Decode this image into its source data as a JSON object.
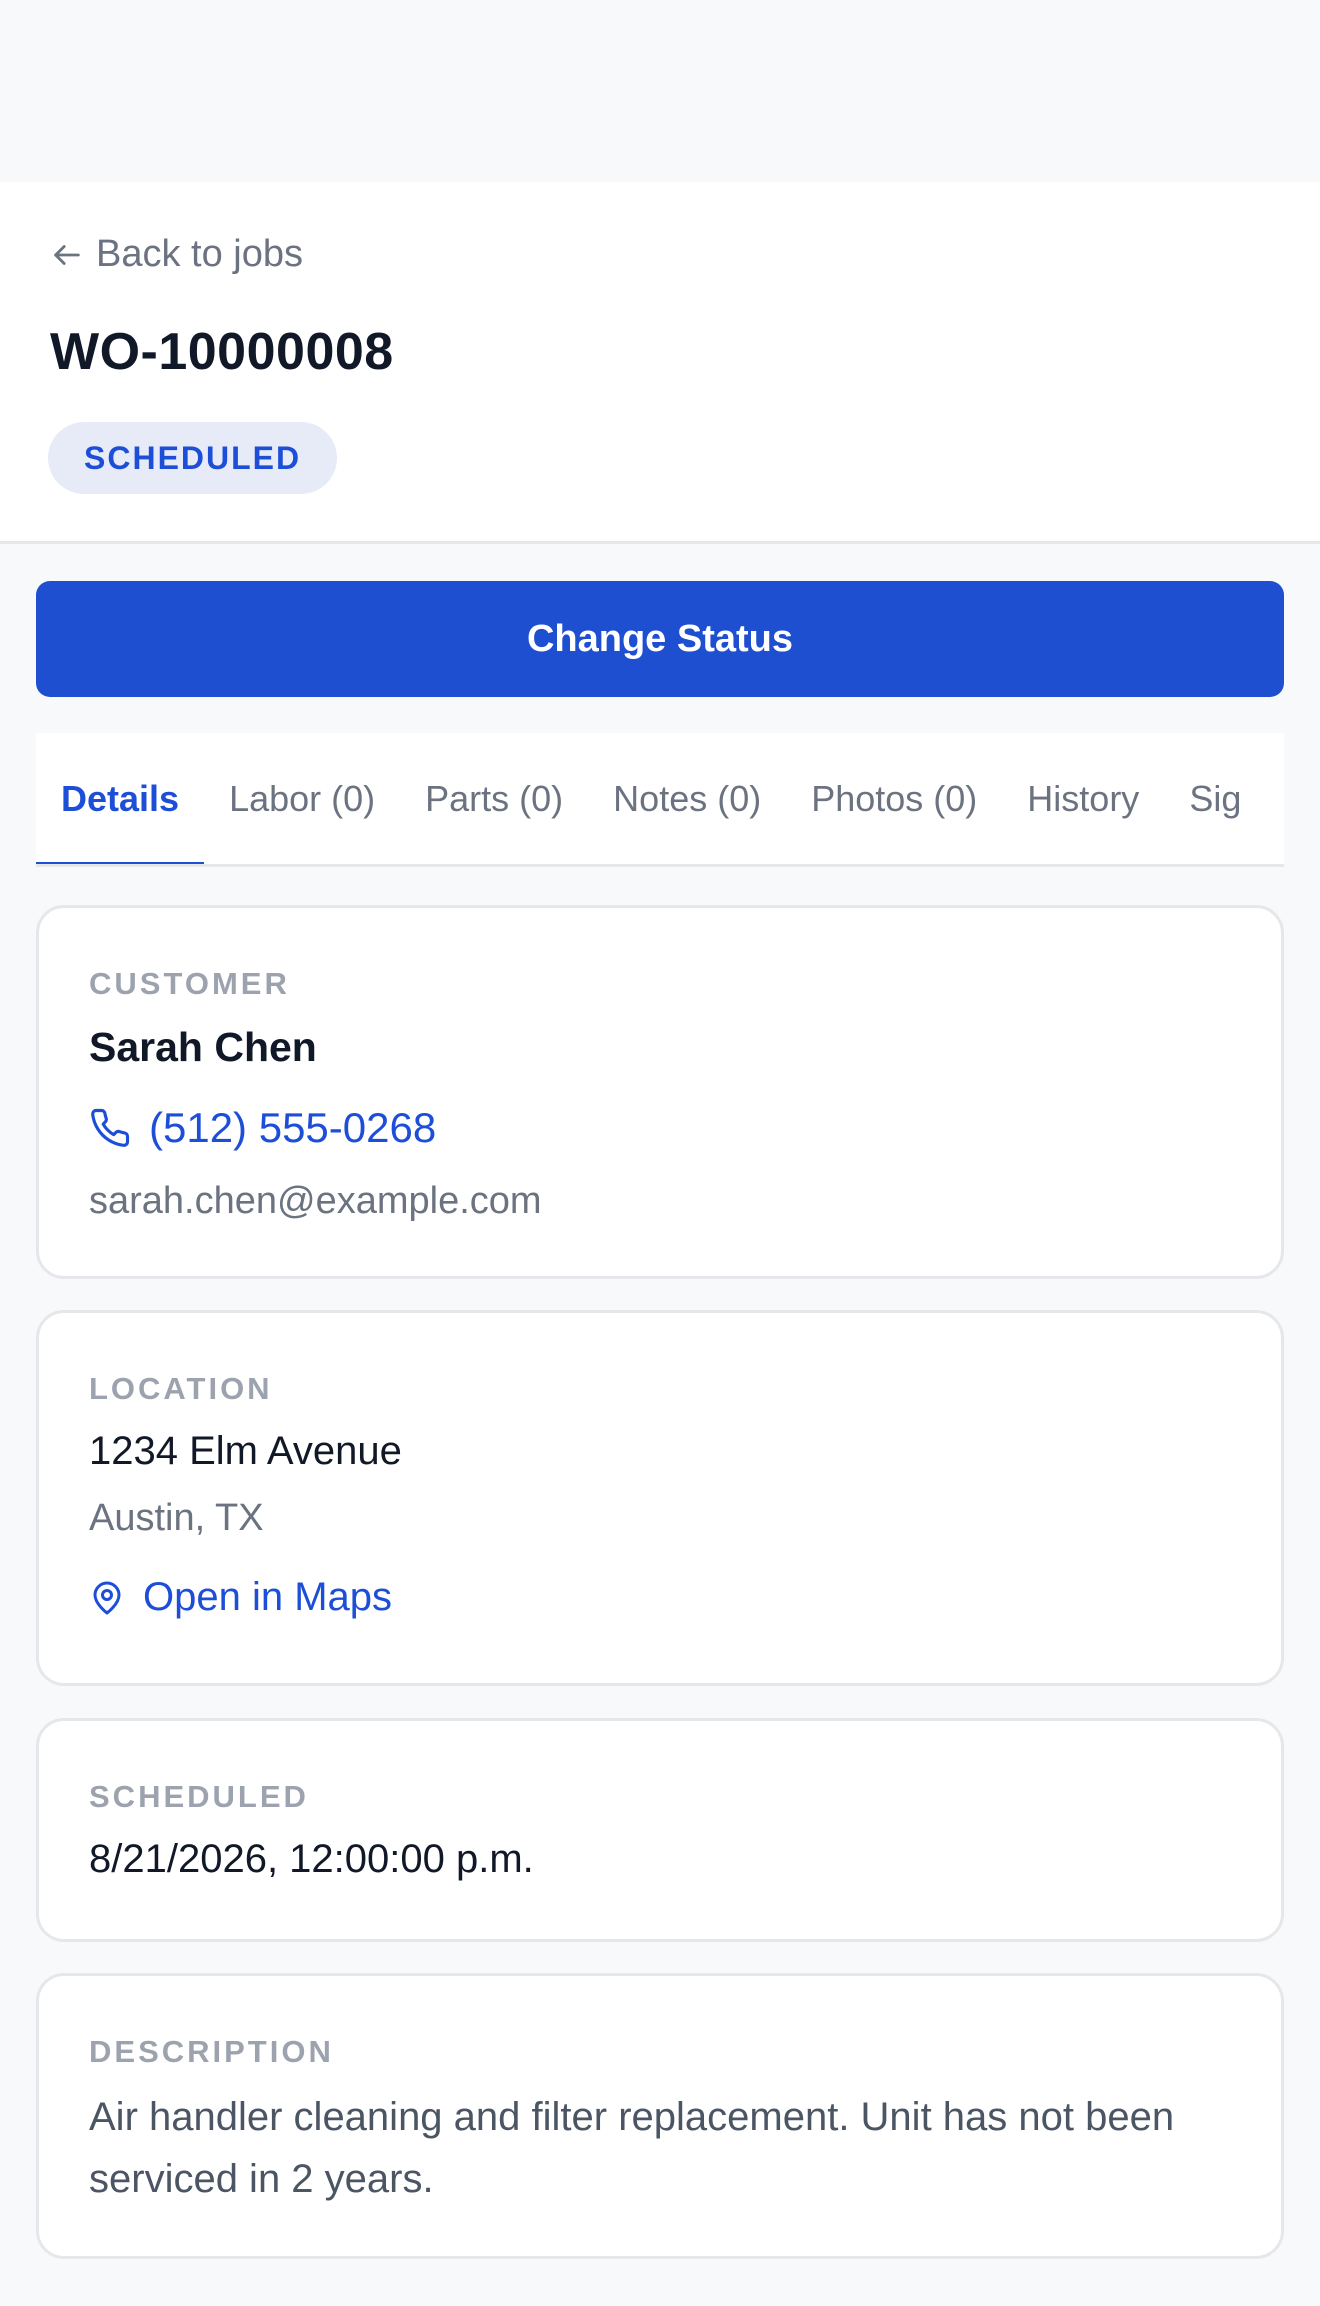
{
  "header": {
    "back_label": "Back to jobs",
    "job_number": "WO-10000008",
    "status": "SCHEDULED"
  },
  "actions": {
    "change_status_label": "Change Status"
  },
  "tabs": [
    {
      "label": "Details",
      "active": true
    },
    {
      "label": "Labor (0)",
      "active": false
    },
    {
      "label": "Parts (0)",
      "active": false
    },
    {
      "label": "Notes (0)",
      "active": false
    },
    {
      "label": "Photos (0)",
      "active": false
    },
    {
      "label": "History",
      "active": false
    },
    {
      "label": "Sig",
      "active": false
    }
  ],
  "customer": {
    "label": "CUSTOMER",
    "name": "Sarah Chen",
    "phone": "(512) 555-0268",
    "email": "sarah.chen@example.com"
  },
  "location": {
    "label": "LOCATION",
    "street": "1234 Elm Avenue",
    "city": "Austin, TX",
    "maps_label": "Open in Maps"
  },
  "scheduled": {
    "label": "SCHEDULED",
    "datetime": "8/21/2026, 12:00:00 p.m."
  },
  "description": {
    "label": "DESCRIPTION",
    "text": "Air handler cleaning and filter replacement. Unit has not been serviced in 2 years."
  },
  "colors": {
    "accent": "#1d4fd0",
    "status_pill_bg": "#e6ebf7",
    "background": "#f8f9fb"
  }
}
